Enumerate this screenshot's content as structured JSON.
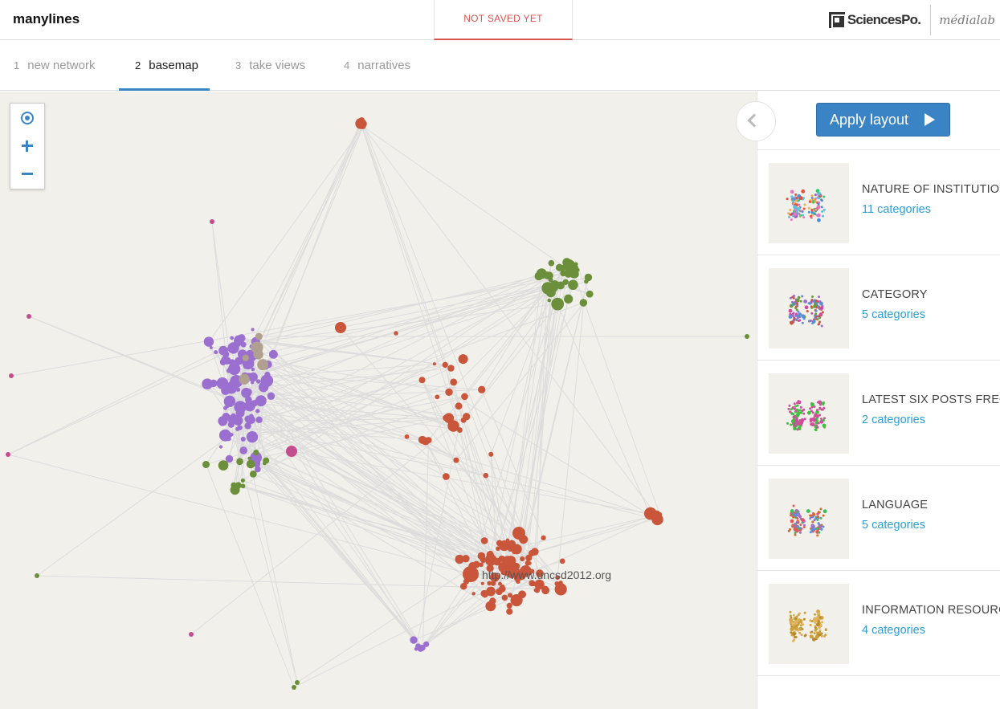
{
  "app": {
    "title": "manylines",
    "save_status": "NOT SAVED YET"
  },
  "brand": {
    "sciencespo": "SciencesPo.",
    "medialab": "médialab"
  },
  "steps": [
    {
      "num": "1",
      "label": "new network",
      "active": false
    },
    {
      "num": "2",
      "label": "basemap",
      "active": true
    },
    {
      "num": "3",
      "label": "take views",
      "active": false
    },
    {
      "num": "4",
      "label": "narratives",
      "active": false
    }
  ],
  "map": {
    "node_label": "http://www.uncsd2012.org"
  },
  "panel": {
    "apply_label": "Apply layout",
    "categories": [
      {
        "title": "NATURE OF INSTITUTION",
        "count": "11 categories",
        "palette": [
          "#4a90d9",
          "#5bc0de",
          "#e74c3c",
          "#9b59b6",
          "#2ecc71",
          "#f0ad4e",
          "#e377c2"
        ]
      },
      {
        "title": "CATEGORY",
        "count": "5 categories",
        "palette": [
          "#c9553a",
          "#6b9a3a",
          "#9b6fd0",
          "#d04d9b",
          "#5b8fd9"
        ]
      },
      {
        "title": "LATEST SIX POSTS FREQUENCY",
        "count": "2 categories",
        "palette": [
          "#3cbf3c",
          "#d04d9b"
        ]
      },
      {
        "title": "LANGUAGE",
        "count": "5 categories",
        "palette": [
          "#e35a5a",
          "#3cbf5a",
          "#d46a2a",
          "#9b6fd0",
          "#5b8fd9"
        ]
      },
      {
        "title": "INFORMATION RESOURCES",
        "count": "4 categories",
        "palette": [
          "#c9a03a",
          "#d4a84a",
          "#b88a2a",
          "#e0b45a"
        ]
      }
    ]
  },
  "colors": {
    "accent": "#3a83c4",
    "warning": "#d9534f",
    "link": "#2a9fd6",
    "node_purple": "#9b6fd0",
    "node_orange": "#c9553a",
    "node_green": "#6b8f3a",
    "node_pink": "#c44d8e",
    "node_tan": "#b0a090",
    "edge": "#dcdcdc"
  }
}
